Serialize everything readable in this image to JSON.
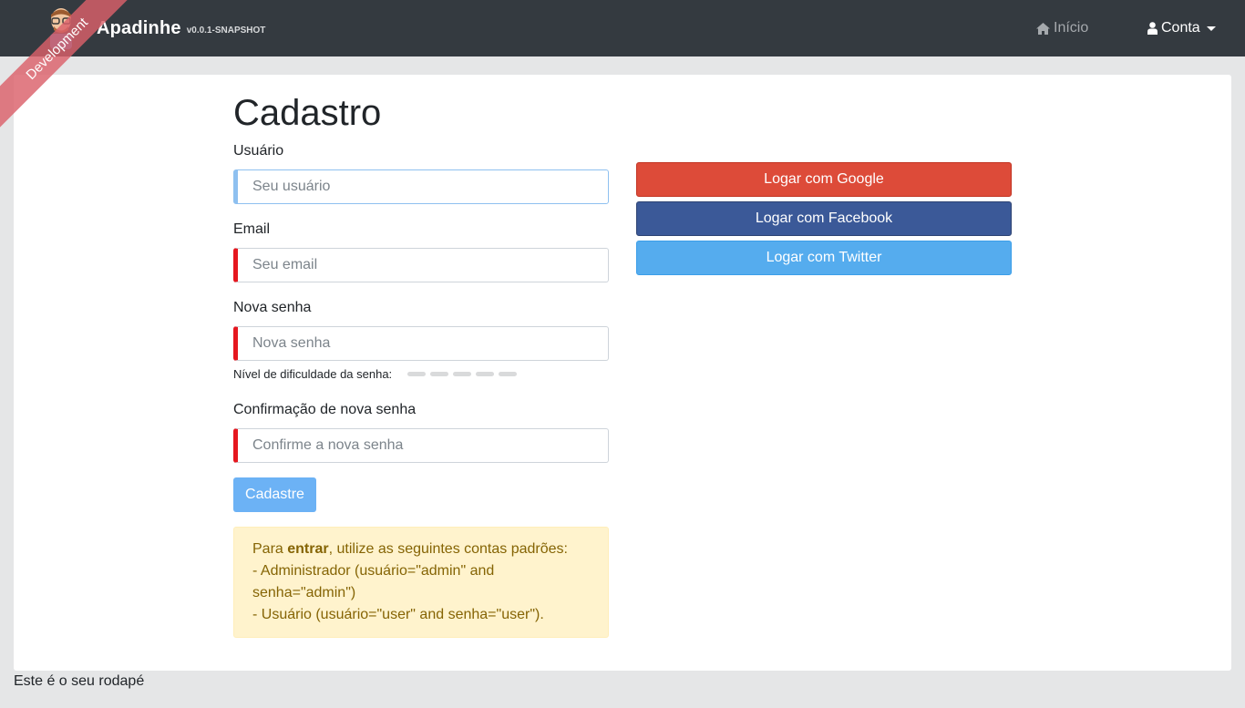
{
  "navbar": {
    "brand_name": "Apadinhe",
    "version": "v0.0.1-SNAPSHOT",
    "home_label": "Início",
    "account_label": "Conta"
  },
  "ribbon": {
    "text": "Development"
  },
  "page": {
    "title": "Cadastro"
  },
  "form": {
    "username": {
      "label": "Usuário",
      "placeholder": "Seu usuário",
      "value": ""
    },
    "email": {
      "label": "Email",
      "placeholder": "Seu email",
      "value": ""
    },
    "new_password": {
      "label": "Nova senha",
      "placeholder": "Nova senha",
      "value": ""
    },
    "strength_label": "Nível de dificuldade da senha:",
    "confirm_password": {
      "label": "Confirmação de nova senha",
      "placeholder": "Confirme a nova senha",
      "value": ""
    },
    "submit_label": "Cadastre"
  },
  "alert": {
    "intro_prefix": "Para ",
    "intro_bold": "entrar",
    "intro_suffix": ", utilize as seguintes contas padrões:",
    "line1": "- Administrador (usuário=\"admin\" and senha=\"admin\")",
    "line2": "- Usuário (usuário=\"user\" and senha=\"user\")."
  },
  "social": {
    "google": "Logar com Google",
    "facebook": "Logar com Facebook",
    "twitter": "Logar com Twitter"
  },
  "footer": {
    "text": "Este é o seu rodapé"
  },
  "colors": {
    "navbar_bg": "#343a40",
    "google": "#dd4b39",
    "facebook": "#3b5998",
    "twitter": "#55acee",
    "submit": "#6cb2f5",
    "alert_bg": "#fff3cd",
    "alert_text": "#856404",
    "invalid_border": "#e5171f"
  },
  "icons": {
    "home": "home-icon",
    "account": "user-icon",
    "logo": "avatar-logo"
  }
}
